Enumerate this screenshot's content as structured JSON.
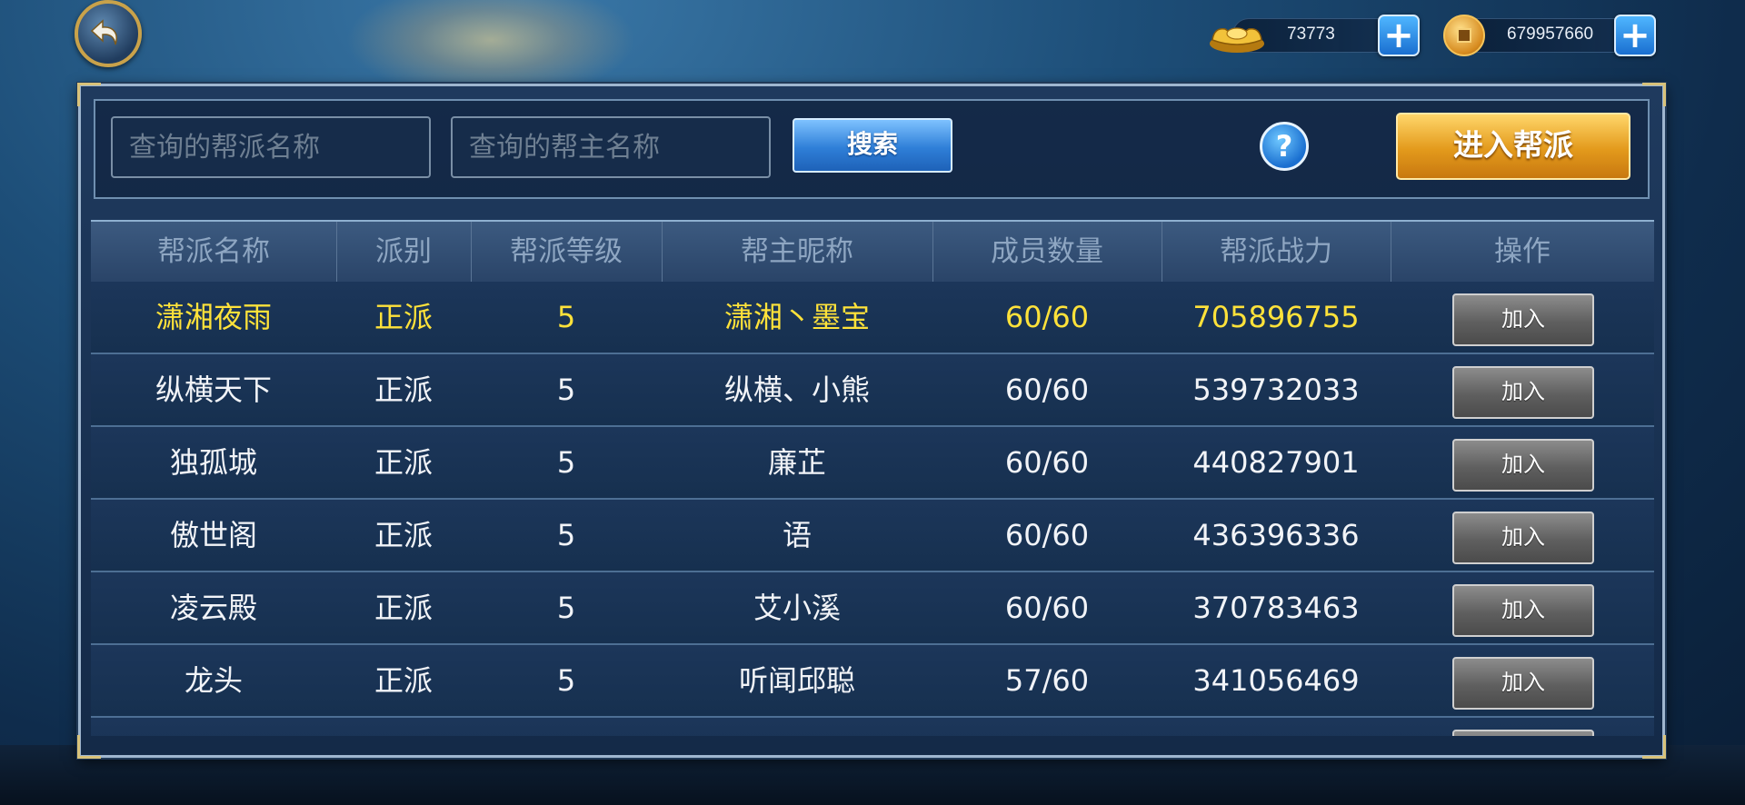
{
  "currency": {
    "ingot_icon": "gold-ingot-icon",
    "ingot_value": "73773",
    "coin_icon": "copper-coin-icon",
    "coin_value": "679957660",
    "plus_label": "+"
  },
  "search": {
    "guild_name_placeholder": "查询的帮派名称",
    "leader_name_placeholder": "查询的帮主名称",
    "search_label": "搜索",
    "help_label": "?",
    "enter_guild_label": "进入帮派"
  },
  "table": {
    "headers": [
      "帮派名称",
      "派别",
      "帮派等级",
      "帮主昵称",
      "成员数量",
      "帮派战力",
      "操作"
    ],
    "rows": [
      {
        "name": "潇湘夜雨",
        "faction": "正派",
        "level": "5",
        "leader": "潇湘丶墨宝",
        "members": "60/60",
        "power": "705896755",
        "action": "加入",
        "highlight": true
      },
      {
        "name": "纵横天下",
        "faction": "正派",
        "level": "5",
        "leader": "纵横、小熊",
        "members": "60/60",
        "power": "539732033",
        "action": "加入",
        "highlight": false
      },
      {
        "name": "独孤城",
        "faction": "正派",
        "level": "5",
        "leader": "廉芷",
        "members": "60/60",
        "power": "440827901",
        "action": "加入",
        "highlight": false
      },
      {
        "name": "傲世阁",
        "faction": "正派",
        "level": "5",
        "leader": "语",
        "members": "60/60",
        "power": "436396336",
        "action": "加入",
        "highlight": false
      },
      {
        "name": "凌云殿",
        "faction": "正派",
        "level": "5",
        "leader": "艾小溪",
        "members": "60/60",
        "power": "370783463",
        "action": "加入",
        "highlight": false
      },
      {
        "name": "龙头",
        "faction": "正派",
        "level": "5",
        "leader": "听闻邱聪",
        "members": "57/60",
        "power": "341056469",
        "action": "加入",
        "highlight": false
      }
    ]
  },
  "colors": {
    "highlight_text": "#ffe23a",
    "normal_text": "#f2f4f8",
    "header_text": "#8ea6c2",
    "enter_button": "#e39a1c",
    "search_button": "#2f7fd8"
  }
}
